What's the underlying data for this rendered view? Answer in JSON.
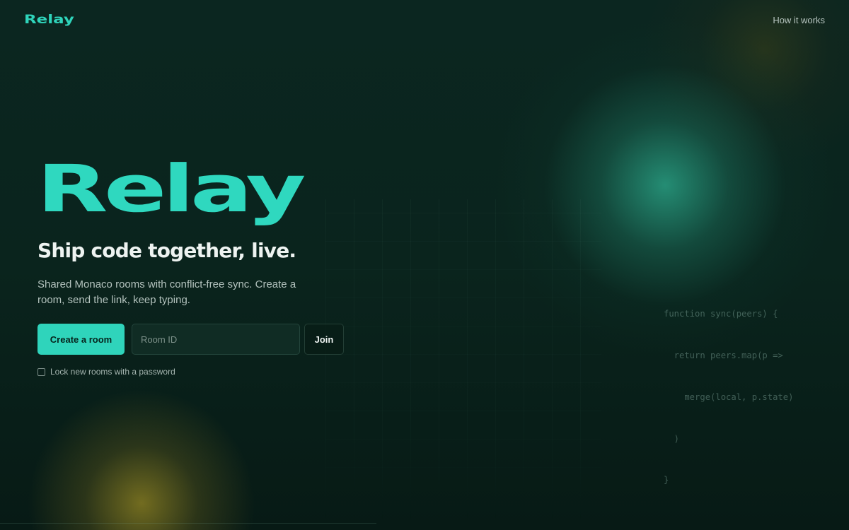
{
  "nav": {
    "brand": "Relay",
    "how_it_works": "How it works"
  },
  "hero": {
    "title": "Relay",
    "tagline": "Ship code together, live.",
    "description": "Shared Monaco rooms with conflict-free sync. Create a room, send the link, keep typing."
  },
  "actions": {
    "create_room": "Create a room",
    "room_id_placeholder": "Room ID",
    "room_id_value": "",
    "join": "Join",
    "lock_label": "Lock new rooms with a password",
    "lock_checked": false
  },
  "code_snippet": {
    "lines": [
      "function sync(peers) {",
      "  return peers.map(p =>",
      "    merge(local, p.state)",
      "  )",
      "}"
    ]
  },
  "colors": {
    "accent": "#2fd4bb",
    "background": "#08201a"
  }
}
